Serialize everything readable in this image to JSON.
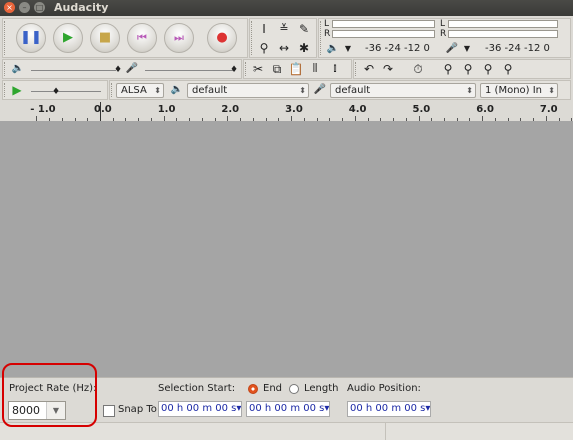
{
  "window": {
    "title": "Audacity"
  },
  "transport": {
    "pause_icon": "pause-icon",
    "play_icon": "play-icon",
    "stop_icon": "stop-icon",
    "skip_start_icon": "skip-start-icon",
    "skip_end_icon": "skip-end-icon",
    "record_icon": "record-icon"
  },
  "meters": {
    "play": {
      "L": "L",
      "R": "R",
      "scale": "-36 -24 -12 0"
    },
    "record": {
      "L": "L",
      "R": "R",
      "scale": "-36 -24 -12 0"
    }
  },
  "device": {
    "host": "ALSA",
    "playback": "default",
    "recording": "default",
    "channels": "1 (Mono) In"
  },
  "ruler": {
    "labels": [
      "- 1.0",
      "0.0",
      "1.0",
      "2.0",
      "3.0",
      "4.0",
      "5.0",
      "6.0",
      "7.0"
    ]
  },
  "status": {
    "project_rate_label": "Project Rate (Hz):",
    "project_rate_value": "8000",
    "snap_to_label": "Snap To",
    "selection_start_label": "Selection Start:",
    "end_label": "End",
    "length_label": "Length",
    "audio_position_label": "Audio Position:",
    "selection_start_value": "00 h 00 m 00 s",
    "end_value": "00 h 00 m 00 s",
    "audio_position_value": "00 h 00 m 00 s"
  },
  "colors": {
    "accent": "#e2531e",
    "highlight": "#d60000",
    "time_text": "#1d2aa6"
  }
}
